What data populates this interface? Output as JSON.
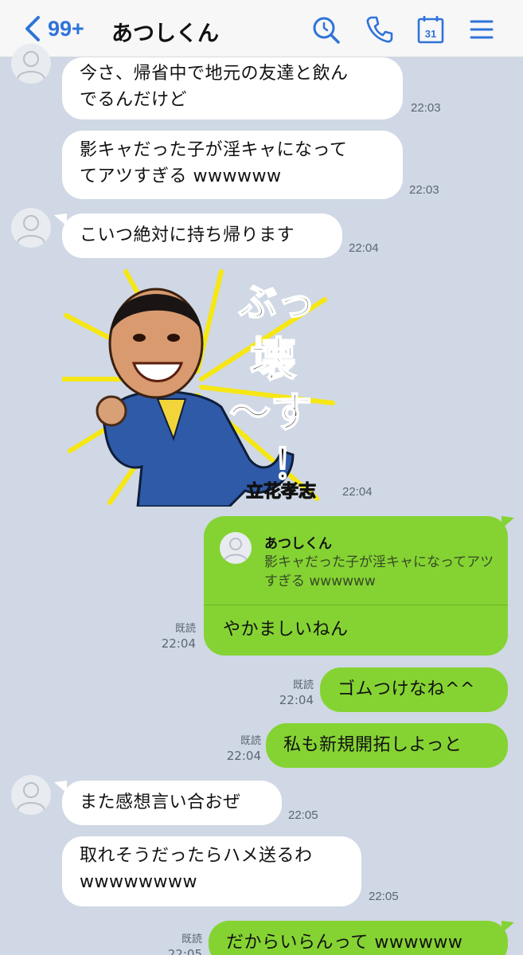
{
  "header": {
    "back_count": "99+",
    "title": "あつしくん",
    "icons": [
      "search-icon",
      "phone-icon",
      "calendar-icon",
      "menu-icon"
    ],
    "calendar_day": "31"
  },
  "colors": {
    "accent": "#2f73d9",
    "background": "#cfd8e4",
    "outgoing_bubble": "#85d333",
    "incoming_bubble": "#ffffff"
  },
  "messages": [
    {
      "id": "m1",
      "direction": "in",
      "lines": [
        "今さ、帰省中で地元の友達と飲ん",
        "でるんだけど"
      ],
      "time": "22:03"
    },
    {
      "id": "m2",
      "direction": "in",
      "lines": [
        "影キャだった子が淫キャになって",
        "てアツすぎる wwwwww"
      ],
      "time": "22:03"
    },
    {
      "id": "m3",
      "direction": "in",
      "lines": [
        "こいつ絶対に持ち帰ります"
      ],
      "time": "22:04"
    },
    {
      "id": "m4",
      "direction": "in",
      "type": "sticker",
      "sticker_text": "ぶっ壊〜す！",
      "sticker_name": "立花孝志",
      "time": "22:04"
    },
    {
      "id": "m5",
      "direction": "out",
      "reply_to": {
        "name": "あつしくん",
        "text": "影キャだった子が淫キャになってアツすぎる wwwwww"
      },
      "text": "やかましいねん",
      "read": "既読",
      "time": "22:04"
    },
    {
      "id": "m6",
      "direction": "out",
      "text": "ゴムつけなね^^",
      "read": "既読",
      "time": "22:04"
    },
    {
      "id": "m7",
      "direction": "out",
      "text": "私も新規開拓しよっと",
      "read": "既読",
      "time": "22:04"
    },
    {
      "id": "m8",
      "direction": "in",
      "lines": [
        "また感想言い合おぜ"
      ],
      "time": "22:05"
    },
    {
      "id": "m9",
      "direction": "in",
      "lines": [
        "取れそうだったらハメ送るわ",
        "wwwwwwww"
      ],
      "time": "22:05"
    },
    {
      "id": "m10",
      "direction": "out",
      "text": "だからいらんって wwwwww",
      "read": "既読",
      "time": "22:05"
    }
  ]
}
